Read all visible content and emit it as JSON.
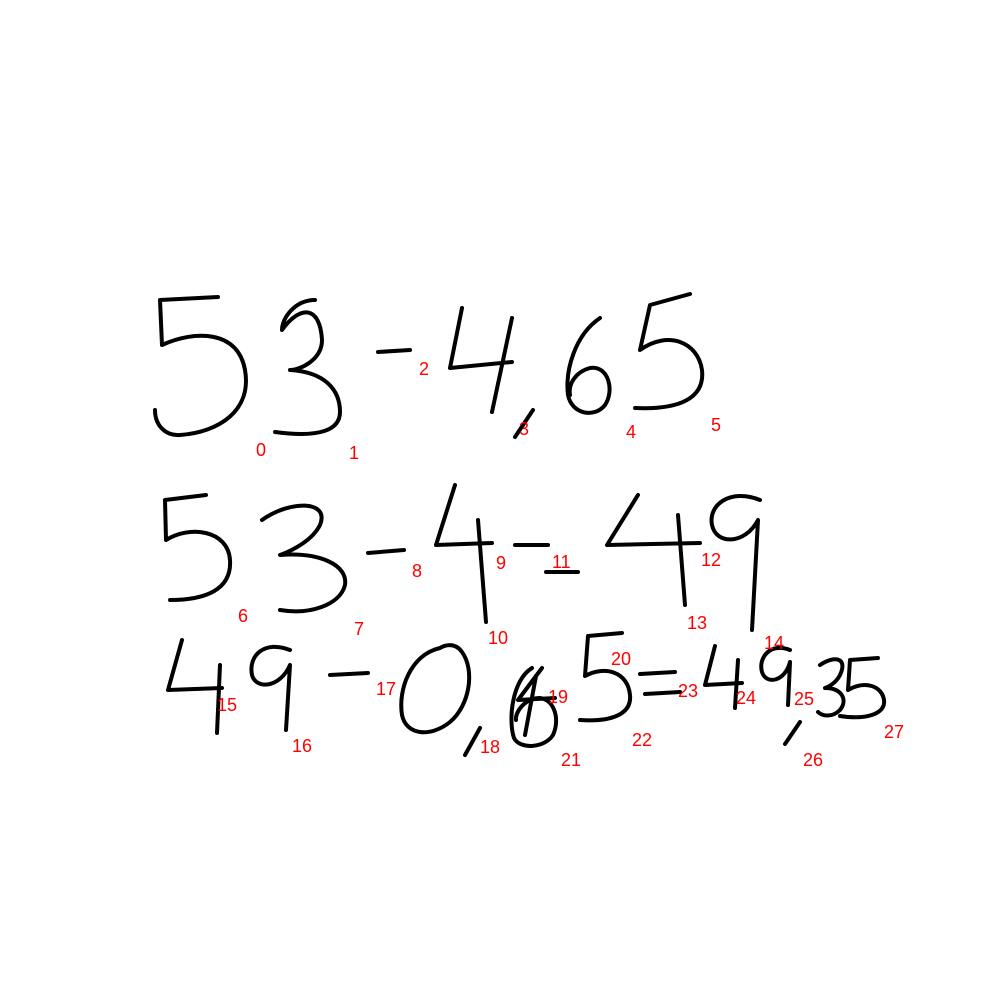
{
  "ink_color": "#000000",
  "label_color": "#ff0000",
  "handwriting": {
    "lines": [
      "53-4,65",
      "53-4-49",
      "49-0,65=49,35"
    ]
  },
  "stroke_labels": [
    "0",
    "1",
    "2",
    "3",
    "4",
    "5",
    "6",
    "7",
    "8",
    "9",
    "10",
    "11",
    "12",
    "13",
    "14",
    "15",
    "16",
    "17",
    "18",
    "19",
    "20",
    "21",
    "22",
    "23",
    "24",
    "25",
    "26",
    "27"
  ]
}
